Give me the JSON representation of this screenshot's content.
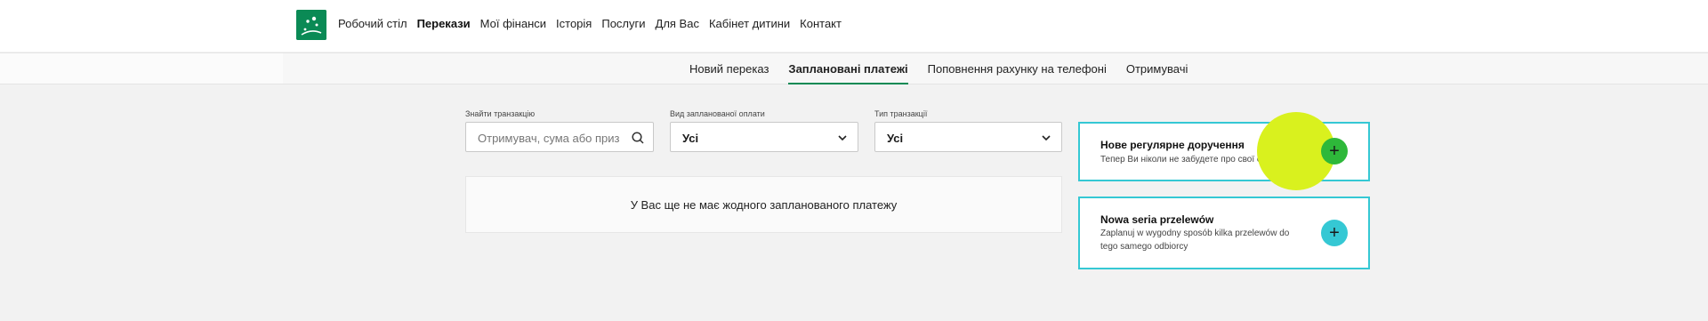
{
  "main_nav": {
    "items": [
      "Робочий стіл",
      "Перекази",
      "Мої фінанси",
      "Історія",
      "Послуги",
      "Для Вас",
      "Кабінет дитини",
      "Контакт"
    ],
    "active": "Перекази"
  },
  "sub_nav": {
    "tabs": [
      "Новий переказ",
      "Заплановані платежі",
      "Поповнення рахунку на телефоні",
      "Отримувачі"
    ],
    "active": "Заплановані платежі"
  },
  "filters": {
    "search": {
      "label": "Знайти транзакцію",
      "placeholder": "Отримувач, сума або призна..."
    },
    "payment_type": {
      "label": "Вид запланованої оплати",
      "value": "Усі"
    },
    "transaction_type": {
      "label": "Тип транзакції",
      "value": "Усі"
    }
  },
  "empty_message": "У Вас ще не має жодного запланованого платежу",
  "cards": [
    {
      "title": "Нове регулярне доручення",
      "description": "Тепер Ви ніколи не забудете про свої оплати"
    },
    {
      "title": "Nowa seria przelewów",
      "description": "Zaplanuj w wygodny sposób kilka przelewów do tego samego odbiorcy"
    }
  ],
  "colors": {
    "brand": "#0a8a55",
    "card_border": "#35c8d4",
    "plus_green": "#2eb83a",
    "plus_cyan": "#35c8d4",
    "highlight": "#d9f11e"
  },
  "icons": {
    "search": "search-icon",
    "dropdown": "chevron-down-icon",
    "add": "plus-icon"
  }
}
